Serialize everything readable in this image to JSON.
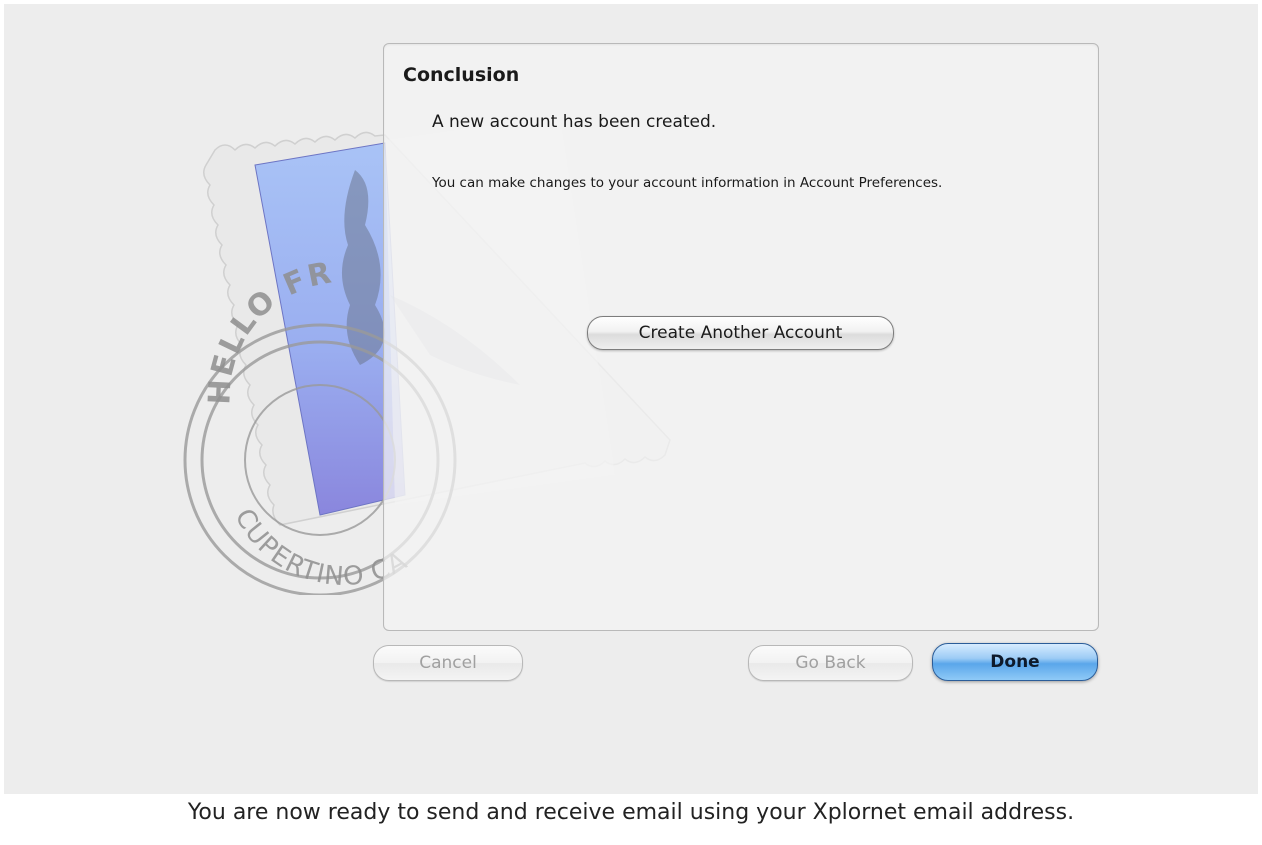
{
  "panel": {
    "title": "Conclusion",
    "created_message": "A new account has been created.",
    "prefs_message": "You can make changes to your account information in Account Preferences."
  },
  "stamp": {
    "postmark_top": "HELLO FR",
    "postmark_bottom": "CUPERTINO CA"
  },
  "buttons": {
    "create_another": "Create Another Account",
    "cancel": "Cancel",
    "go_back": "Go Back",
    "done": "Done"
  },
  "caption": "You are now ready to send and receive email using your Xplornet email address.",
  "colors": {
    "dialog_background": "#ededed",
    "stamp_blue": "#8aa8ee",
    "stamp_purple": "#8a86dd",
    "default_button": "#5aa6ea"
  }
}
